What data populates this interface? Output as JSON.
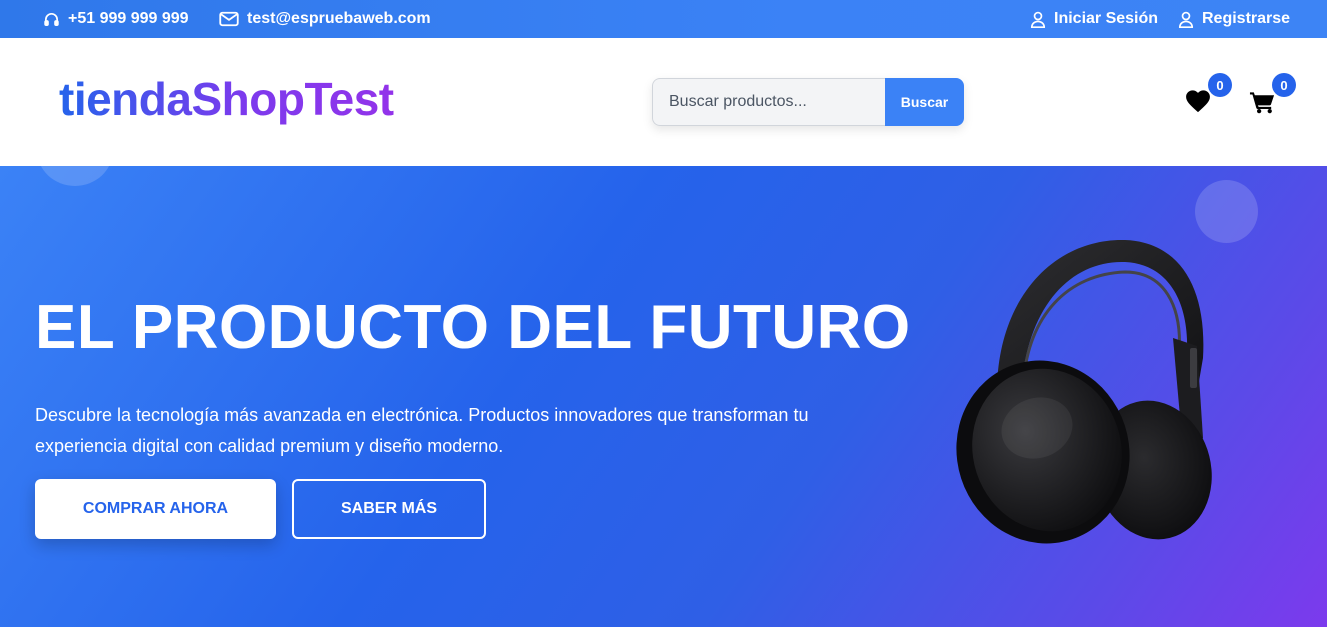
{
  "topbar": {
    "phone": "+51 999 999 999",
    "email": "test@espruebaweb.com",
    "login": "Iniciar Sesión",
    "register": "Registrarse"
  },
  "header": {
    "logo": "tiendaShopTest",
    "search_placeholder": "Buscar productos...",
    "search_button": "Buscar",
    "wishlist_count": "0",
    "cart_count": "0"
  },
  "hero": {
    "title": "EL PRODUCTO DEL FUTURO",
    "description": "Descubre la tecnología más avanzada en electrónica. Productos innovadores que transforman tu experiencia digital con calidad premium y diseño moderno.",
    "primary_button": "COMPRAR AHORA",
    "secondary_button": "SABER MÁS",
    "image": "headphones"
  },
  "colors": {
    "primary": "#3b82f6",
    "primary_dark": "#2563eb",
    "accent_purple": "#7c3aed"
  },
  "icons": {
    "phone": "headset-icon",
    "email": "envelope-icon",
    "user": "user-icon",
    "wishlist": "heart-icon",
    "cart": "cart-icon"
  }
}
